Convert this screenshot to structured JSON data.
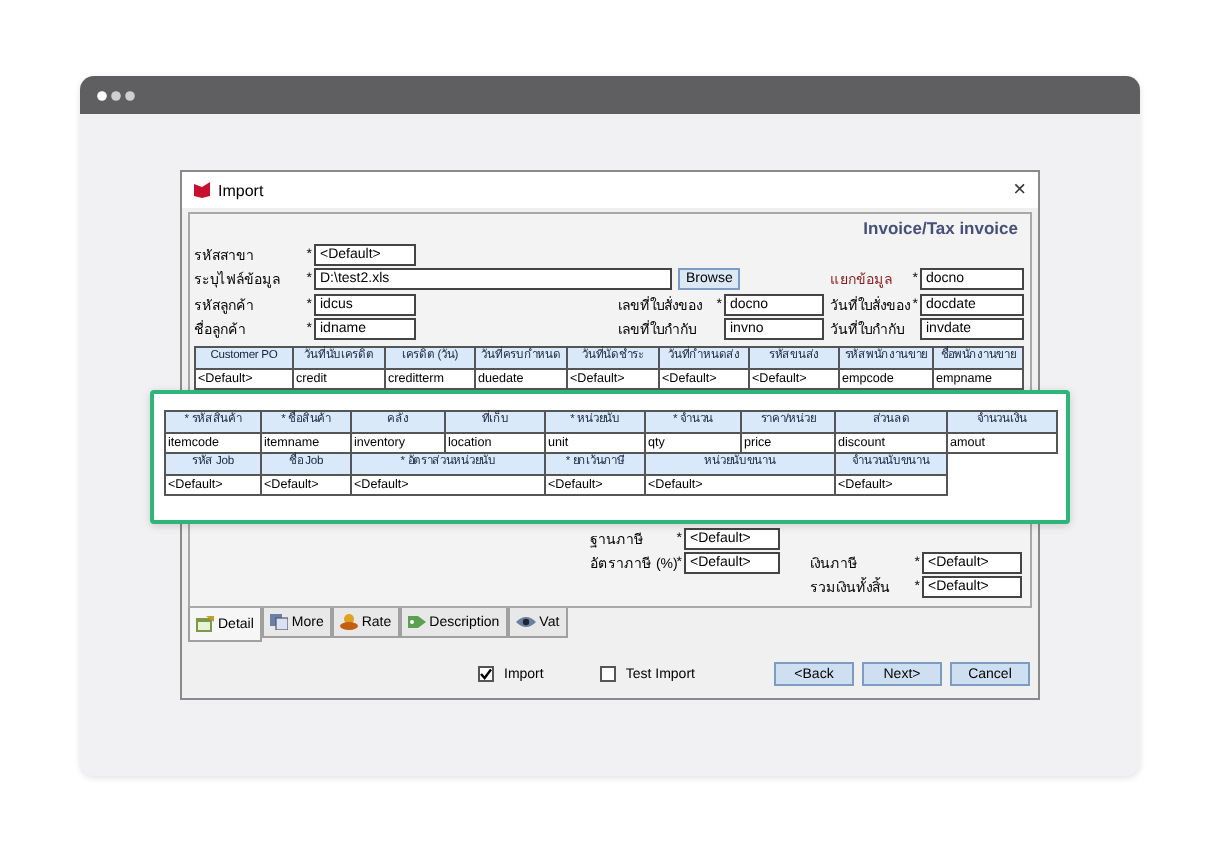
{
  "dialog": {
    "title": "Import",
    "close": "×",
    "heading": "Invoice/Tax invoice"
  },
  "file_fields": [
    {
      "label": "รหัสสาขา",
      "mark": "*",
      "value": "<Default>"
    },
    {
      "label": "ระบุไฟล์ข้อมูล",
      "mark": "*",
      "value": "D:\\test2.xls"
    },
    {
      "label": "รหัสลูกค้า",
      "mark": "*",
      "value": "idcus"
    },
    {
      "label": "ชื่อลูกค้า",
      "mark": "*",
      "value": "idname"
    }
  ],
  "browse_button": "Browse",
  "document_fields": [
    {
      "label": "เลขที่ใบสั่งของ",
      "mark": "*",
      "value": "docno"
    },
    {
      "label": "เลขที่ใบกำกับ",
      "value": "invno"
    }
  ],
  "split_fields": [
    {
      "label": "แยกข้อมูล",
      "mark": "*",
      "value": "docno",
      "color": "#8b1a1a"
    },
    {
      "label": "วันที่ใบสั่งของ",
      "mark": "*",
      "value": "docdate"
    },
    {
      "label": "วันที่ใบกำกับ",
      "value": "invdate"
    }
  ],
  "header_table": {
    "columns": [
      "Customer PO",
      "วันที่นับเครดิต",
      "เครดิต (วัน)",
      "วันที่ครบกำหนด",
      "วันที่นัดชำระ",
      "วันที่กำหนดส่ง",
      "รหัสขนส่ง",
      "รหัสพนักงานขาย",
      "ชื่อพนักงานขาย"
    ],
    "values": [
      "<Default>",
      "credit",
      "creditterm",
      "duedate",
      "<Default>",
      "<Default>",
      "<Default>",
      "empcode",
      "empname"
    ]
  },
  "item_table": {
    "columns": [
      "* รหัสสินค้า",
      "* ชื่อสินค้า",
      "คลัง",
      "ที่เก็บ",
      "* หน่วยนับ",
      "* จำนวน",
      "ราคา/หน่วย",
      "ส่วนลด",
      "จำนวนเงิน"
    ],
    "values": [
      "itemcode",
      "itemname",
      "inventory",
      "location",
      "unit",
      "qty",
      "price",
      "discount",
      "amout"
    ],
    "columns_2": [
      "รหัส Job",
      "ชื่อ Job",
      "* อัตราส่วนหน่วยนับ",
      "* ยกเว้นภาษี",
      "หน่วยนับขนาน",
      "จำนวนนับขนาน"
    ],
    "values_2": [
      "<Default>",
      "<Default>",
      "<Default>",
      "<Default>",
      "<Default>",
      "<Default>"
    ]
  },
  "tax_fields": [
    {
      "label": "ฐานภาษี",
      "mark": "*",
      "value": "<Default>"
    },
    {
      "label": "อัตราภาษี (%)",
      "mark": "*",
      "value": "<Default>"
    }
  ],
  "total_fields": [
    {
      "label": "เงินภาษี",
      "mark": "*",
      "value": "<Default>"
    },
    {
      "label": "รวมเงินทั้งสิ้น",
      "mark": "*",
      "value": "<Default>"
    }
  ],
  "tabs": [
    {
      "label": "Detail",
      "selected": true
    },
    {
      "label": "More",
      "selected": false
    },
    {
      "label": "Rate",
      "selected": false
    },
    {
      "label": "Description",
      "selected": false
    },
    {
      "label": "Vat",
      "selected": false
    }
  ],
  "checkboxes": [
    {
      "label": "Import",
      "checked": true
    },
    {
      "label": "Test Import",
      "checked": false
    }
  ],
  "buttons": [
    "<Back",
    "Next>",
    "Cancel"
  ]
}
